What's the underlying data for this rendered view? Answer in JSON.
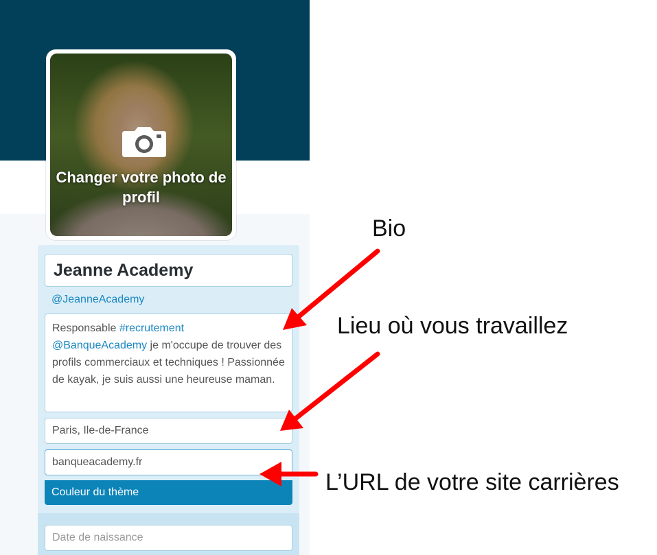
{
  "profile": {
    "change_photo_label": "Changer votre photo de profil",
    "name": "Jeanne Academy",
    "handle": "@JeanneAcademy",
    "bio": {
      "part1": "Responsable ",
      "hashtag": "#recrutement",
      "mention": "@BanqueAcademy",
      "part2": " je m'occupe de trouver des profils commerciaux et techniques ! Passionnée de kayak, je suis aussi une heureuse maman."
    },
    "location": "Paris, Ile-de-France",
    "website": "banqueacademy.fr",
    "theme_button_label": "Couleur du thème",
    "birthdate_placeholder": "Date de naissance"
  },
  "annotations": {
    "bio": "Bio",
    "location": "Lieu où vous travaillez",
    "url": "L’URL de votre site carrières",
    "arrow_color": "#ff0000"
  },
  "colors": {
    "banner": "#024059",
    "accent": "#0d84b8",
    "link": "#1b87c2"
  },
  "icons": {
    "camera": "camera-icon"
  }
}
